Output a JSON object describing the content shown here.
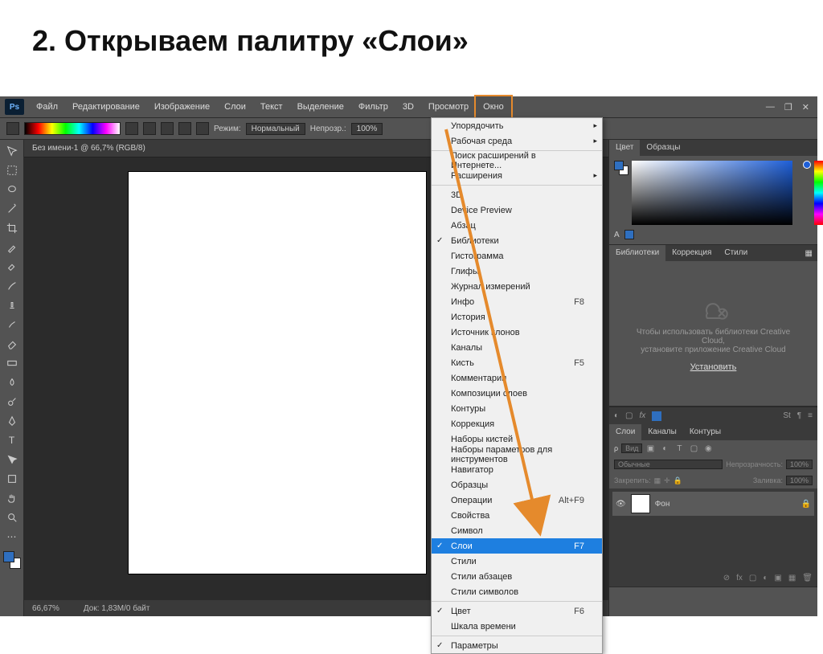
{
  "slide": {
    "title": "2. Открываем палитру «Слои»"
  },
  "ps_logo": "Ps",
  "menubar": [
    "Файл",
    "Редактирование",
    "Изображение",
    "Слои",
    "Текст",
    "Выделение",
    "Фильтр",
    "3D",
    "Просмотр",
    "Окно"
  ],
  "menubar_highlight": "Окно",
  "optionbar": {
    "mode_label": "Режим:",
    "mode_value": "Нормальный",
    "opacity_label": "Непрозр.:",
    "opacity_value": "100%"
  },
  "document_tab": "Без имени-1 @ 66,7% (RGB/8)",
  "statusbar": {
    "zoom": "66,67%",
    "doc": "Док: 1,83M/0 байт"
  },
  "panels": {
    "color_tabs": [
      "Цвет",
      "Образцы"
    ],
    "lib_tabs": [
      "Библиотеки",
      "Коррекция",
      "Стили"
    ],
    "lib_msg1": "Чтобы использовать библиотеки Creative Cloud,",
    "lib_msg2": "установите приложение Creative Cloud",
    "lib_install": "Установить",
    "layers_tabs": [
      "Слои",
      "Каналы",
      "Контуры"
    ],
    "layers_search_ph": "Вид",
    "layers_mode": "Обычные",
    "layers_opacity_lbl": "Непрозрачность:",
    "layers_opacity_val": "100%",
    "layers_lock_lbl": "Закрепить:",
    "layers_fill_lbl": "Заливка:",
    "layers_fill_val": "100%",
    "layer_name": "Фон"
  },
  "dropdown": [
    {
      "label": "Упорядочить",
      "sub": true
    },
    {
      "label": "Рабочая среда",
      "sub": true
    },
    {
      "sep": true
    },
    {
      "label": "Поиск расширений в Интернете..."
    },
    {
      "label": "Расширения",
      "sub": true
    },
    {
      "sep": true
    },
    {
      "label": "3D"
    },
    {
      "label": "Device Preview"
    },
    {
      "label": "Абзац"
    },
    {
      "label": "Библиотеки",
      "chk": true
    },
    {
      "label": "Гистограмма"
    },
    {
      "label": "Глифы"
    },
    {
      "label": "Журнал измерений"
    },
    {
      "label": "Инфо",
      "shortcut": "F8"
    },
    {
      "label": "История"
    },
    {
      "label": "Источник клонов"
    },
    {
      "label": "Каналы"
    },
    {
      "label": "Кисть",
      "shortcut": "F5"
    },
    {
      "label": "Комментарии"
    },
    {
      "label": "Композиции слоев"
    },
    {
      "label": "Контуры"
    },
    {
      "label": "Коррекция"
    },
    {
      "label": "Наборы кистей"
    },
    {
      "label": "Наборы параметров для инструментов"
    },
    {
      "label": "Навигатор"
    },
    {
      "label": "Образцы"
    },
    {
      "label": "Операции",
      "shortcut": "Alt+F9"
    },
    {
      "label": "Свойства"
    },
    {
      "label": "Символ"
    },
    {
      "label": "Слои",
      "shortcut": "F7",
      "chk": true,
      "sel": true
    },
    {
      "label": "Стили"
    },
    {
      "label": "Стили абзацев"
    },
    {
      "label": "Стили символов"
    },
    {
      "sep": true
    },
    {
      "label": "Цвет",
      "shortcut": "F6",
      "chk": true
    },
    {
      "label": "Шкала времени"
    },
    {
      "sep": true
    },
    {
      "label": "Параметры",
      "chk": true
    }
  ]
}
